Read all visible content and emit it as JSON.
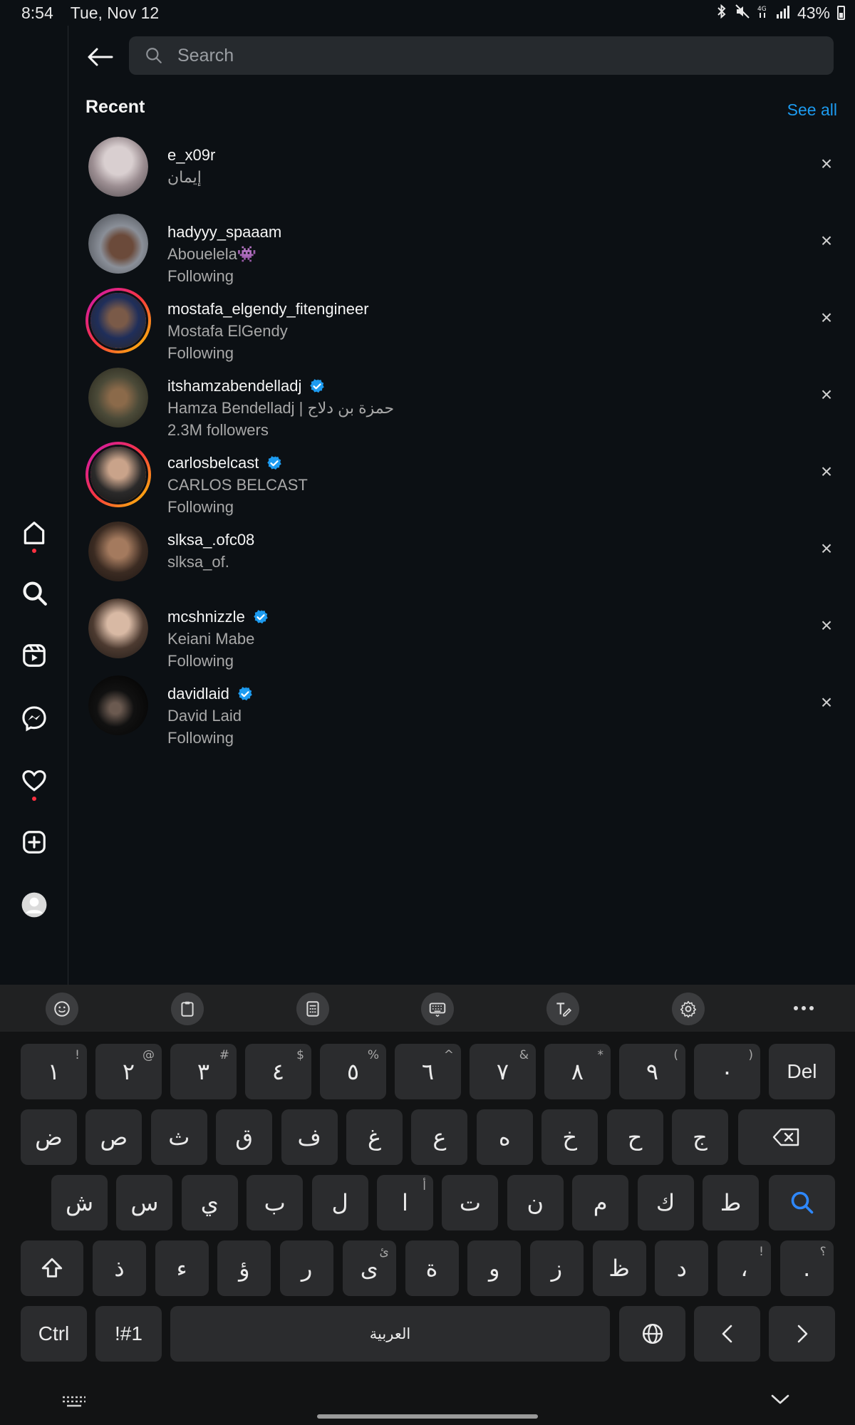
{
  "status_bar": {
    "time": "8:54",
    "date": "Tue, Nov 12",
    "battery": "43%"
  },
  "search": {
    "placeholder": "Search"
  },
  "recent": {
    "title": "Recent",
    "see_all": "See all",
    "items": [
      {
        "username": "e_x09r",
        "name": "إيمان",
        "detail": "",
        "verified": false
      },
      {
        "username": "hadyyy_spaaam",
        "name": "Abouelela👾",
        "detail": "Following",
        "verified": false
      },
      {
        "username": "mostafa_elgendy_fitengineer",
        "name": "Mostafa ElGendy",
        "detail": "Following",
        "verified": false
      },
      {
        "username": "itshamzabendelladj",
        "name": "Hamza Bendelladj | حمزة بن دلاج",
        "detail": "2.3M followers",
        "verified": true
      },
      {
        "username": "carlosbelcast",
        "name": "CARLOS BELCAST",
        "detail": "Following",
        "verified": true
      },
      {
        "username": "slksa_.ofc08",
        "name": "slksa_of.",
        "detail": "",
        "verified": false
      },
      {
        "username": "mcshnizzle",
        "name": "Keiani Mabe",
        "detail": "Following",
        "verified": true
      },
      {
        "username": "davidlaid",
        "name": "David Laid",
        "detail": "Following",
        "verified": true
      }
    ],
    "remove_symbol": "×"
  },
  "keyboard": {
    "row1": [
      {
        "k": "١",
        "h": "!"
      },
      {
        "k": "٢",
        "h": "@"
      },
      {
        "k": "٣",
        "h": "#"
      },
      {
        "k": "٤",
        "h": "$"
      },
      {
        "k": "٥",
        "h": "%"
      },
      {
        "k": "٦",
        "h": "^"
      },
      {
        "k": "٧",
        "h": "&"
      },
      {
        "k": "٨",
        "h": "*"
      },
      {
        "k": "٩",
        "h": "("
      },
      {
        "k": "٠",
        "h": ")"
      }
    ],
    "del_label": "Del",
    "row2": [
      "ض",
      "ص",
      "ث",
      "ق",
      "ف",
      "غ",
      "ع",
      "ه",
      "خ",
      "ح",
      "ج"
    ],
    "row3": [
      {
        "k": "ش",
        "h": ""
      },
      {
        "k": "س",
        "h": ""
      },
      {
        "k": "ي",
        "h": ""
      },
      {
        "k": "ب",
        "h": ""
      },
      {
        "k": "ل",
        "h": ""
      },
      {
        "k": "ا",
        "h": "أ"
      },
      {
        "k": "ت",
        "h": ""
      },
      {
        "k": "ن",
        "h": ""
      },
      {
        "k": "م",
        "h": ""
      },
      {
        "k": "ك",
        "h": ""
      },
      {
        "k": "ط",
        "h": ""
      }
    ],
    "row4": [
      {
        "k": "ذ",
        "h": ""
      },
      {
        "k": "ء",
        "h": ""
      },
      {
        "k": "ؤ",
        "h": ""
      },
      {
        "k": "ر",
        "h": ""
      },
      {
        "k": "ى",
        "h": "ئ"
      },
      {
        "k": "ة",
        "h": ""
      },
      {
        "k": "و",
        "h": ""
      },
      {
        "k": "ز",
        "h": ""
      },
      {
        "k": "ظ",
        "h": ""
      },
      {
        "k": "د",
        "h": ""
      },
      {
        "k": "،",
        "h": "!"
      },
      {
        "k": ".",
        "h": "؟"
      }
    ],
    "ctrl_label": "Ctrl",
    "symbols_label": "!#1",
    "space_label": "العربية"
  }
}
